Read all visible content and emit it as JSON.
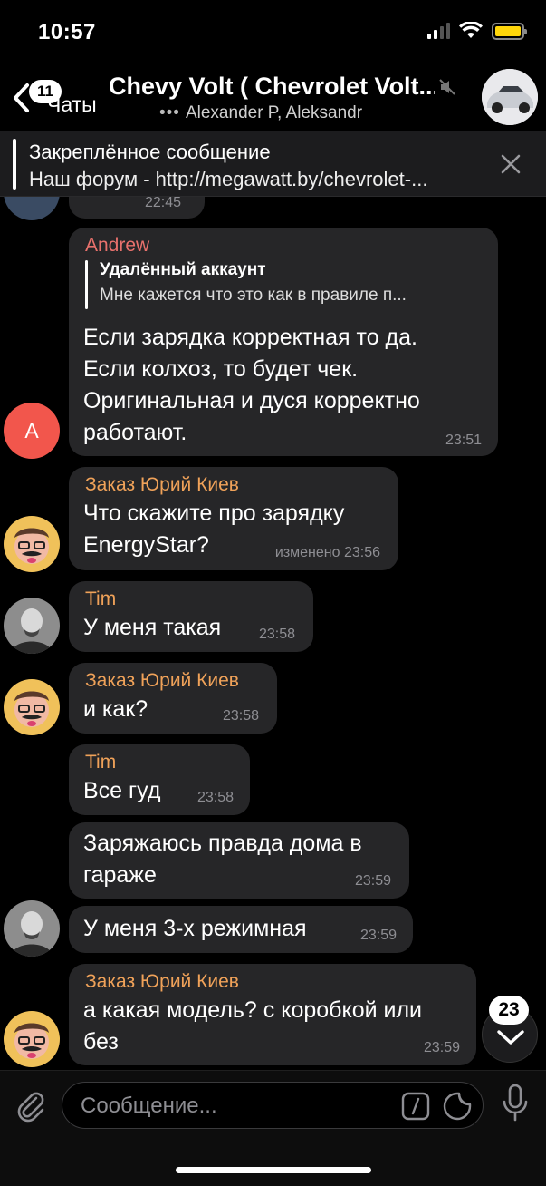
{
  "status_bar": {
    "time": "10:57"
  },
  "header": {
    "back_label": "Чаты",
    "unread_badge": "11",
    "title": "Chevy Volt ( Chevrolet Volt...",
    "subtitle": "Alexander P, Aleksandr",
    "typing_dots": "•••"
  },
  "pinned": {
    "title": "Закреплённое сообщение",
    "text": "Наш форум - http://megawatt.by/chevrolet-..."
  },
  "partial_top_time": "22:45",
  "messages": [
    {
      "sender": "Andrew",
      "reply": {
        "name": "Удалённый аккаунт",
        "text": "Мне кажется что это как в правиле п..."
      },
      "lines": [
        "Если зарядка корректная то да.",
        "Если колхоз, то будет чек.",
        "Оригинальная и дуся корректно",
        "работают."
      ],
      "time": "23:51",
      "avatar_letter": "A"
    },
    {
      "sender": "Заказ Юрий Киев",
      "lines": [
        "Что скажите про зарядку",
        "EnergyStar?"
      ],
      "time": "изменено 23:56"
    },
    {
      "sender": "Tim",
      "lines": [
        "У меня такая"
      ],
      "time": "23:58"
    },
    {
      "sender": "Заказ Юрий Киев",
      "lines": [
        "и как?"
      ],
      "time": "23:58"
    },
    {
      "sender": "Tim",
      "lines": [
        "Все гуд"
      ],
      "time": "23:58"
    },
    {
      "lines": [
        "Заряжаюсь правда дома в",
        "гараже"
      ],
      "time": "23:59"
    },
    {
      "lines": [
        "У меня 3-х режимная"
      ],
      "time": "23:59"
    },
    {
      "sender": "Заказ Юрий Киев",
      "lines": [
        "а какая модель? с коробкой или",
        "без"
      ],
      "time": "23:59"
    }
  ],
  "scroll_badge": "23",
  "composer": {
    "placeholder": "Сообщение..."
  },
  "colors": {
    "andrew": "#e8716c",
    "yuriy": "#f0a259",
    "tim": "#f0a259",
    "bubble": "#262628",
    "avatar_a": "#f2564c"
  }
}
